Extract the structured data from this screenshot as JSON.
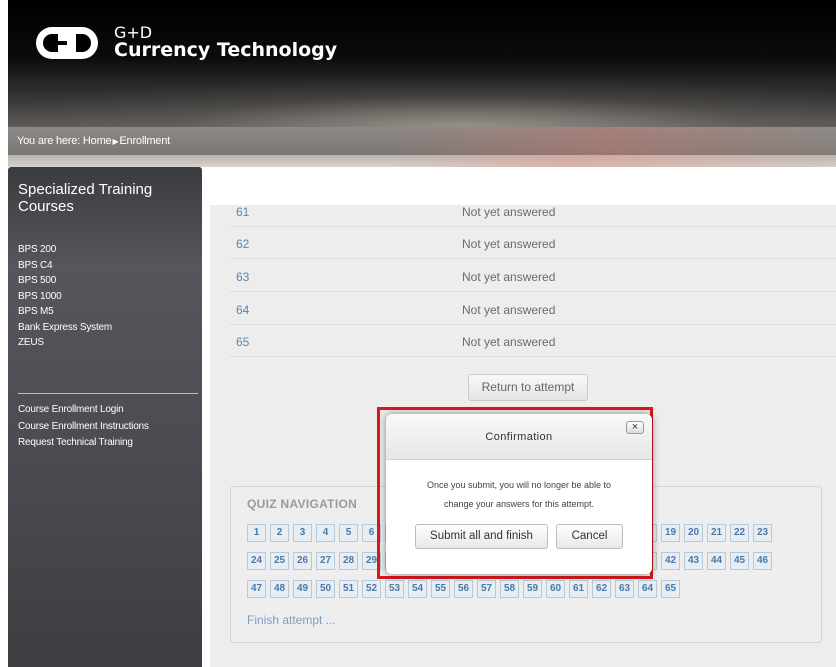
{
  "header": {
    "brand_line1": "G+D",
    "brand_line2": "Currency Technology"
  },
  "breadcrumb": {
    "prefix": "You are here: ",
    "home": "Home",
    "current": "Enrollment"
  },
  "sidebar": {
    "title": "Specialized Training Courses",
    "courses": [
      "BPS 200",
      "BPS C4",
      "BPS 500",
      "BPS 1000",
      "BPS M5",
      "Bank Express System",
      "ZEUS"
    ],
    "links": [
      "Course Enrollment Login",
      "Course Enrollment Instructions",
      "Request Technical Training"
    ]
  },
  "summary": {
    "rows": [
      {
        "num": "61",
        "state": "Not yet answered"
      },
      {
        "num": "62",
        "state": "Not yet answered"
      },
      {
        "num": "63",
        "state": "Not yet answered"
      },
      {
        "num": "64",
        "state": "Not yet answered"
      },
      {
        "num": "65",
        "state": "Not yet answered"
      }
    ],
    "return_label": "Return to attempt"
  },
  "quiz_nav": {
    "title": "QUIZ NAVIGATION",
    "finish_label": "Finish attempt ..."
  },
  "dialog": {
    "title": "Confirmation",
    "close_label": "×",
    "message_line1": "Once you submit, you will no longer be able to",
    "message_line2": "change your answers for this attempt.",
    "submit_label": "Submit all and finish",
    "cancel_label": "Cancel"
  },
  "colors": {
    "highlight": "#d9181c",
    "link": "#5b86b0"
  }
}
